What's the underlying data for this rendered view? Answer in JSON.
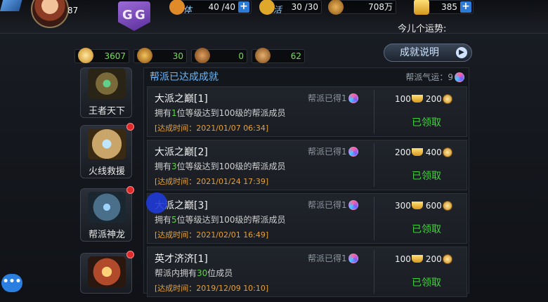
{
  "player": {
    "level": "87"
  },
  "logo": {
    "letters": [
      "G",
      "G"
    ]
  },
  "resources": [
    {
      "icon": "stamina-icon",
      "label": "体",
      "value": "40 /40",
      "has_plus": true,
      "color": "#e08a2a"
    },
    {
      "icon": "energy-icon",
      "label": "活",
      "value": "30 /30",
      "has_plus": false,
      "color": "#e0a82a"
    },
    {
      "icon": "copper-coin-icon",
      "label": "",
      "value": "708万",
      "has_plus": false,
      "color": "#c7851b"
    },
    {
      "icon": "gold-ingot-icon",
      "label": "",
      "value": "385",
      "has_plus": true,
      "color": "#f0c040"
    }
  ],
  "fortune_text": "今儿个运势:",
  "stats": [
    {
      "icon": "coin-icon",
      "value": "3607"
    },
    {
      "icon": "lion-badge-icon",
      "value": "30"
    },
    {
      "icon": "tiger-badge-icon",
      "value": "0"
    },
    {
      "icon": "scroll-badge-icon",
      "value": "62"
    }
  ],
  "explain_button": "成就说明",
  "sidebar": [
    {
      "label": "王者天下",
      "red_dot": false
    },
    {
      "label": "火线救援",
      "red_dot": true
    },
    {
      "label": "帮派神龙",
      "red_dot": true
    },
    {
      "label": "",
      "red_dot": true
    }
  ],
  "panel": {
    "title": "帮派已达成成就",
    "fortune_label": "帮派气运：9"
  },
  "achievements": [
    {
      "name": "大派之巅[1]",
      "desc_pre": "拥有",
      "desc_num": "1",
      "desc_post": "位等级达到100级的帮派成员",
      "time": "[达成时间：2021/01/07  06:34]",
      "got": "帮派已得1",
      "reward_ingot": "100",
      "reward_coin": "200",
      "status": "已领取"
    },
    {
      "name": "大派之巅[2]",
      "desc_pre": "拥有",
      "desc_num": "3",
      "desc_post": "位等级达到100级的帮派成员",
      "time": "[达成时间：2021/01/24  17:39]",
      "got": "帮派已得1",
      "reward_ingot": "200",
      "reward_coin": "400",
      "status": "已领取"
    },
    {
      "name": "大派之巅[3]",
      "desc_pre": "拥有",
      "desc_num": "5",
      "desc_post": "位等级达到100级的帮派成员",
      "time": "[达成时间：2021/02/01  16:49]",
      "got": "帮派已得1",
      "reward_ingot": "300",
      "reward_coin": "600",
      "status": "已领取"
    },
    {
      "name": "英才济济[1]",
      "desc_pre": "帮派内拥有",
      "desc_num": "30",
      "desc_post": "位成员",
      "time": "[达成时间：2019/12/09  10:10]",
      "got": "帮派已得1",
      "reward_ingot": "100",
      "reward_coin": "200",
      "status": "已领取"
    }
  ]
}
